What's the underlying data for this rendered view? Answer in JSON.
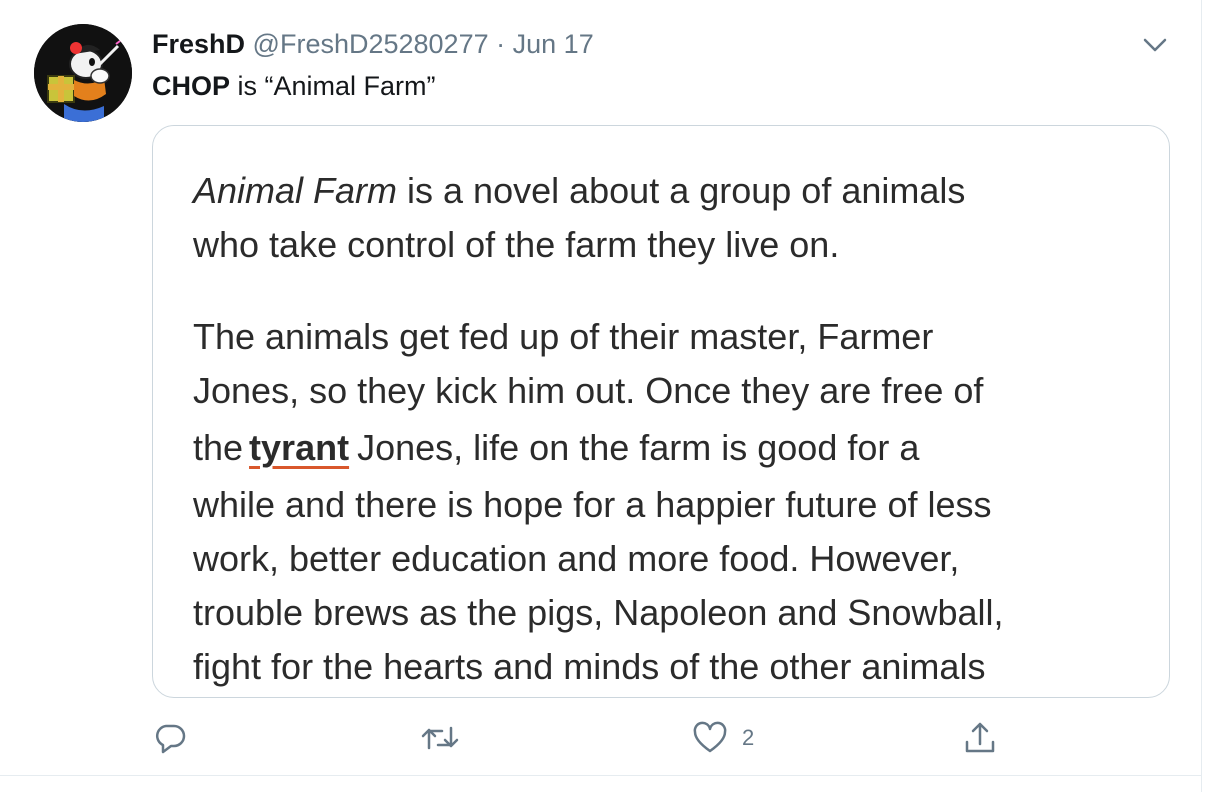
{
  "tweet": {
    "display_name": "FreshD",
    "handle": "@FreshD25280277",
    "separator": "·",
    "date": "Jun 17",
    "text_bold": "CHOP",
    "text_rest": " is “Animal Farm”"
  },
  "card": {
    "para1": {
      "line1_italic": "Animal Farm",
      "line1_rest": " is a novel about a group of animals",
      "line2": "who take control of the farm they live on."
    },
    "para2": {
      "line1": "The animals get fed up of their master, Farmer",
      "line2": "Jones, so they kick him out. Once they are free of",
      "line3_pre": "the",
      "line3_keyword": "tyrant",
      "line3_post": "Jones, life on the farm is good for a",
      "line4": "while and there is hope for a happier future of less",
      "line5": "work, better education and more food. However,",
      "line6": "trouble brews as the pigs, Napoleon and Snowball,",
      "line7": "fight for the hearts and minds of the other animals"
    }
  },
  "actions": {
    "reply_icon": "reply-icon",
    "retweet_icon": "retweet-icon",
    "like_icon": "heart-icon",
    "like_count": "2",
    "share_icon": "share-icon"
  },
  "colors": {
    "secondary_text": "#657786",
    "card_border": "#ccd6dd",
    "keyword_underline": "#d9572b"
  }
}
